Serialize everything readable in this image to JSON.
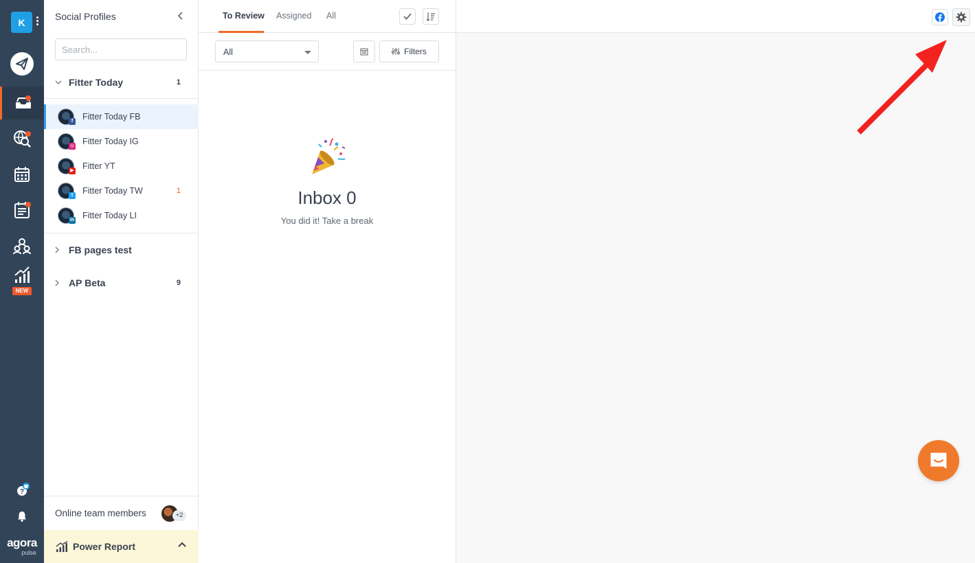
{
  "workspace": {
    "initial": "K"
  },
  "rail": {
    "items": [
      {
        "icon": "paper-plane-icon"
      },
      {
        "icon": "inbox-icon",
        "active": true,
        "dot": true
      },
      {
        "icon": "globe-search-icon",
        "dot": true
      },
      {
        "icon": "calendar-icon"
      },
      {
        "icon": "report-list-icon",
        "dot": true
      },
      {
        "icon": "team-icon"
      },
      {
        "icon": "analytics-icon",
        "badge": "NEW"
      }
    ],
    "brand": {
      "name": "agora",
      "sub": "pulse"
    }
  },
  "profiles": {
    "title": "Social Profiles",
    "search_placeholder": "Search...",
    "groups": [
      {
        "name": "Fitter Today",
        "count": "1",
        "profiles": [
          {
            "name": "Fitter Today FB",
            "network": "f",
            "color": "#3b5998",
            "active": true,
            "count": ""
          },
          {
            "name": "Fitter Today IG",
            "network": "◎",
            "color": "#d6247a",
            "count": ""
          },
          {
            "name": "Fitter YT",
            "network": "▶",
            "color": "#e62117",
            "count": ""
          },
          {
            "name": "Fitter Today TW",
            "network": "t",
            "color": "#1da1f2",
            "count": "1"
          },
          {
            "name": "Fitter Today LI",
            "network": "in",
            "color": "#0e76a8",
            "count": ""
          }
        ]
      },
      {
        "name": "FB pages test",
        "count": ""
      },
      {
        "name": "AP Beta",
        "count": "9"
      }
    ],
    "team": {
      "label": "Online team members",
      "extra": "+2"
    },
    "power_report": {
      "label": "Power Report"
    }
  },
  "inbox": {
    "tabs": [
      "To Review",
      "Assigned",
      "All"
    ],
    "filter_select": {
      "value": "All"
    },
    "filters_label": "Filters",
    "empty": {
      "title": "Inbox 0",
      "subtitle": "You did it! Take a break"
    }
  },
  "colors": {
    "accent": "#ef6a2c",
    "rail": "#324458",
    "facebook": "#1877f2"
  }
}
